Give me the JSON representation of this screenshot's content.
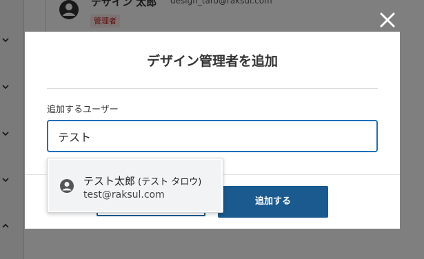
{
  "background": {
    "user": {
      "name": "デザイン 太郎",
      "email": "design_taro@raksul.com",
      "role_badge": "管理者"
    }
  },
  "modal": {
    "title": "デザイン管理者を追加",
    "field_label": "追加するユーザー",
    "input_value": "テスト",
    "cancel_label": "",
    "add_label": "追加する"
  },
  "suggestions": [
    {
      "name": "テスト太郎",
      "kana": "(テスト タロウ)",
      "email": "test@raksul.com"
    }
  ],
  "colors": {
    "accent": "#1a5a8f",
    "input_border": "#1d6fb8",
    "badge_text": "#c21e1e",
    "badge_bg": "#fde8e8"
  },
  "icons": [
    "close-icon",
    "chevron-down-icon",
    "chevron-up-icon",
    "user-avatar-icon"
  ]
}
